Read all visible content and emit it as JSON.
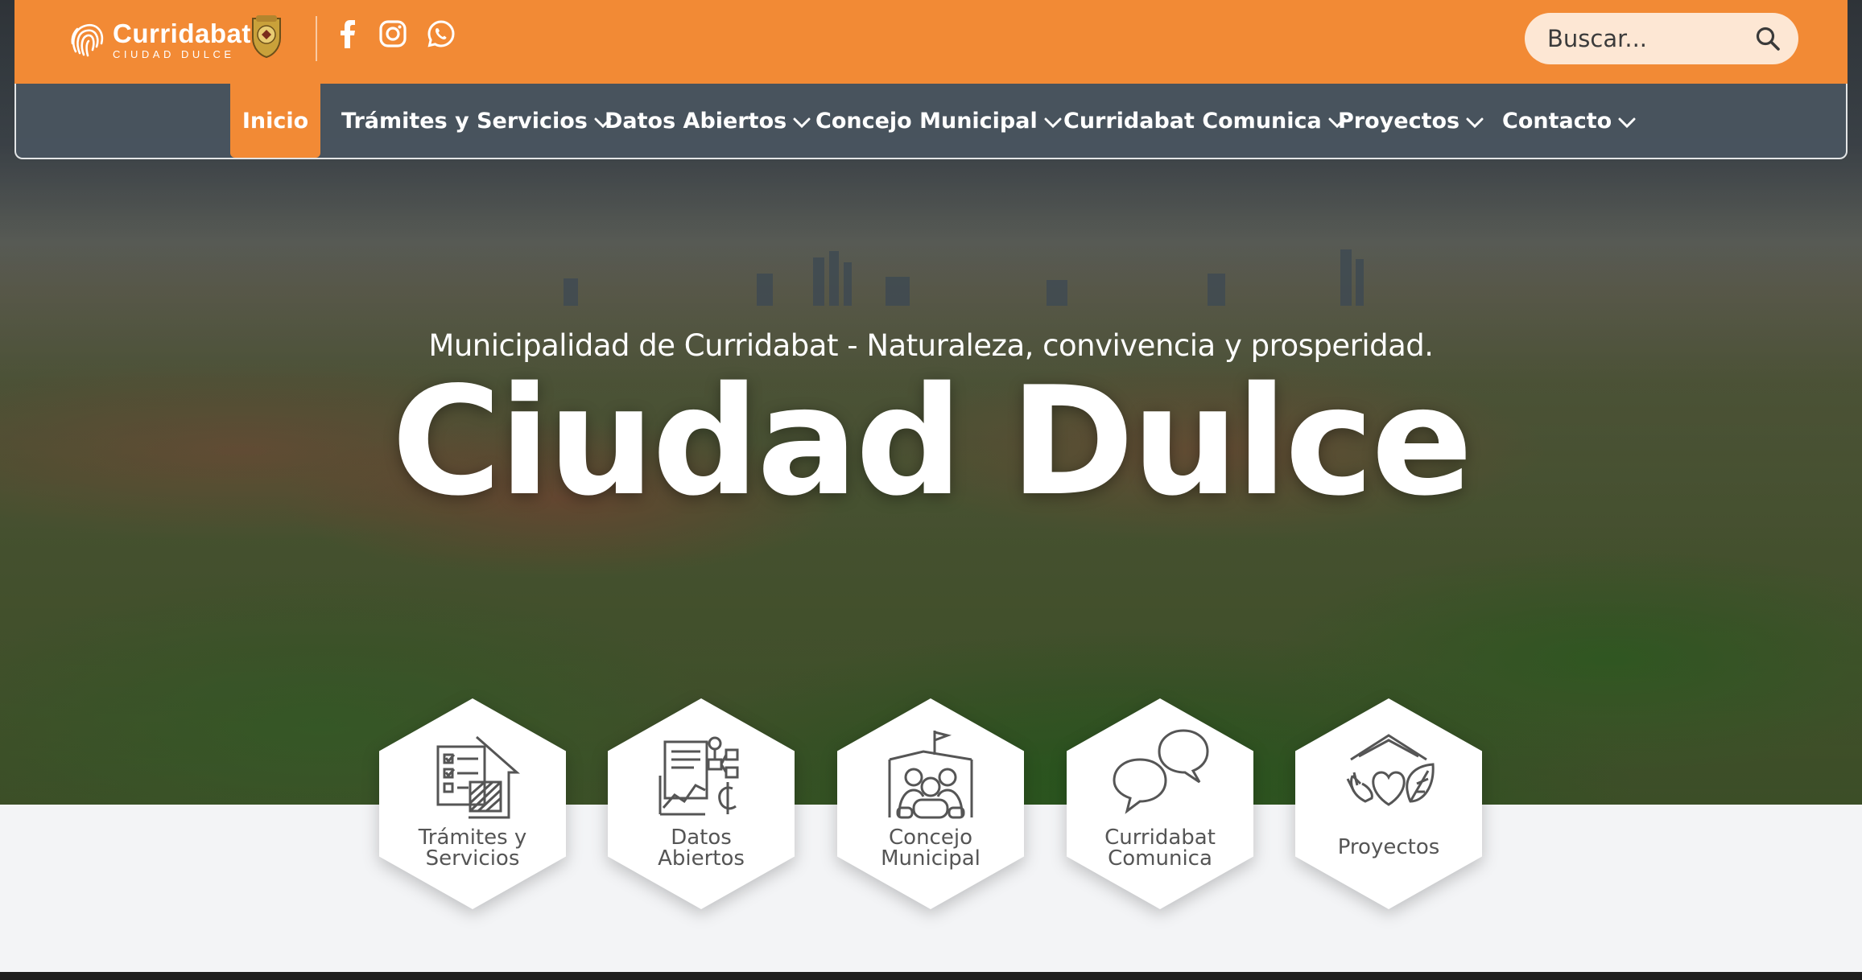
{
  "brand": {
    "title": "Curridabat",
    "subtitle": "CIUDAD DULCE"
  },
  "search": {
    "placeholder": "Buscar..."
  },
  "nav": {
    "items": [
      {
        "label": "Inicio",
        "active": true
      },
      {
        "label": "Trámites y Servicios"
      },
      {
        "label": "Datos Abiertos"
      },
      {
        "label": "Concejo Municipal"
      },
      {
        "label": "Curridabat Comunica"
      },
      {
        "label": "Proyectos"
      },
      {
        "label": "Contacto"
      }
    ]
  },
  "social": [
    "facebook-icon",
    "instagram-icon",
    "whatsapp-icon"
  ],
  "hero": {
    "subtitle": "Municipalidad de Curridabat - Naturaleza, convivencia y prosperidad.",
    "title": "Ciudad Dulce"
  },
  "cards": [
    {
      "line1": "Trámites y",
      "line2": "Servicios",
      "icon": "checklist-house-icon"
    },
    {
      "line1": "Datos",
      "line2": "Abiertos",
      "icon": "data-chart-icon"
    },
    {
      "line1": "Concejo",
      "line2": "Municipal",
      "icon": "council-people-icon"
    },
    {
      "line1": "Curridabat",
      "line2": "Comunica",
      "icon": "chat-bubbles-icon"
    },
    {
      "line1": "Proyectos",
      "line2": "",
      "icon": "heart-leaf-icon"
    }
  ],
  "colors": {
    "brand_orange": "#f28a35",
    "nav_slate": "#49545f",
    "search_bg": "#fde7d4",
    "lower_bg": "#f3f4f6"
  }
}
